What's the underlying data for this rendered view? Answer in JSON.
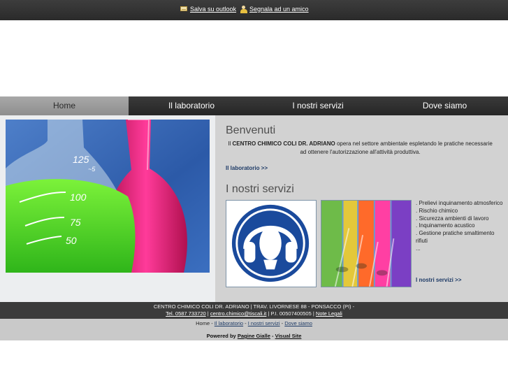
{
  "topbar": {
    "save_outlook": "Salva su outlook",
    "tell_friend": "Segnala ad un amico"
  },
  "nav": {
    "items": [
      {
        "label": "Home"
      },
      {
        "label": "Il laboratorio"
      },
      {
        "label": "I nostri servizi"
      },
      {
        "label": "Dove siamo"
      }
    ]
  },
  "welcome": {
    "title": "Benvenuti",
    "intro_prefix": "Il ",
    "company_bold": "CENTRO CHIMICO COLI DR. ADRIANO",
    "intro_suffix": " opera nel settore ambientale espletando le pratiche necessarie ad ottenere l'autorizzazione all'attività produttiva.",
    "lab_link": "Il laboratorio >>"
  },
  "hero": {
    "flask_label_125": "125",
    "flask_label_100": "100",
    "flask_label_75": "75",
    "flask_label_50": "50",
    "flask_label_mark": "~5"
  },
  "services": {
    "title": "I nostri servizi",
    "items": [
      ". Prelievi inquinamento atmosferico",
      ". Rischio chimico",
      ". Sicurezza ambienti di lavoro",
      ". Inquinamento acustico",
      ". Gestione pratiche smaltimento rifiuti",
      "..."
    ],
    "link": "I nostri servizi >>"
  },
  "footer": {
    "address": "CENTRO CHIMICO COLI DR. ADRIANO | TRAV. LIVORNESE 88 - PONSACCO (PI) -",
    "phone": "Tel. 0587 733720",
    "email": "centro.chimico@tiscali.it",
    "vat": "P.I. 00507400505",
    "legal": "Note Legali",
    "sep": " | ",
    "links": [
      "Home",
      "Il laboratorio",
      "I nostri servizi",
      "Dove siamo"
    ],
    "link_sep": " - ",
    "powered_prefix": "Powered by",
    "pagine_gialle": "Pagine Gialle",
    "visual_site": "Visual Site",
    "powered_dash": " - "
  },
  "colors": {
    "accent_link": "#1d3a66",
    "safety_blue": "#1a4a9c"
  }
}
